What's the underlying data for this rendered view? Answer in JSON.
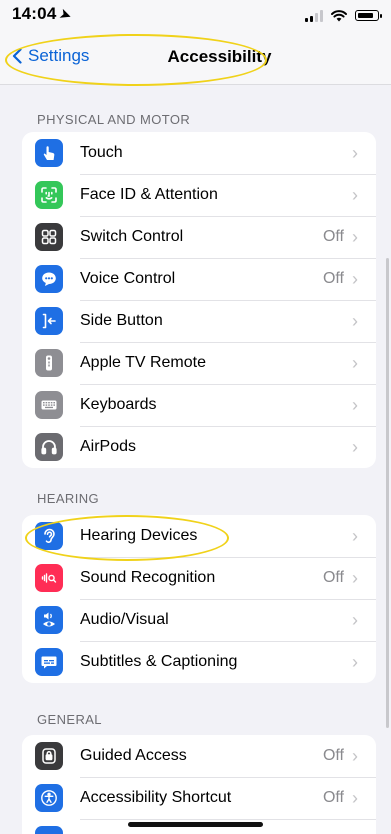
{
  "status": {
    "time": "14:04"
  },
  "nav": {
    "back_label": "Settings",
    "title": "Accessibility"
  },
  "sections": [
    {
      "header": "PHYSICAL AND MOTOR",
      "items": [
        {
          "label": "Touch",
          "value": "",
          "icon": "touch-hand-icon",
          "color": "#1f6fe4"
        },
        {
          "label": "Face ID & Attention",
          "value": "",
          "icon": "face-id-icon",
          "color": "#34c759"
        },
        {
          "label": "Switch Control",
          "value": "Off",
          "icon": "switch-control-icon",
          "color": "#3a3a3c"
        },
        {
          "label": "Voice Control",
          "value": "Off",
          "icon": "voice-control-icon",
          "color": "#1f6fe4"
        },
        {
          "label": "Side Button",
          "value": "",
          "icon": "side-button-icon",
          "color": "#1f6fe4"
        },
        {
          "label": "Apple TV Remote",
          "value": "",
          "icon": "tv-remote-icon",
          "color": "#8e8e93"
        },
        {
          "label": "Keyboards",
          "value": "",
          "icon": "keyboard-icon",
          "color": "#8e8e93"
        },
        {
          "label": "AirPods",
          "value": "",
          "icon": "airpods-icon",
          "color": "#6b6b70"
        }
      ]
    },
    {
      "header": "HEARING",
      "items": [
        {
          "label": "Hearing Devices",
          "value": "",
          "icon": "ear-icon",
          "color": "#1f6fe4"
        },
        {
          "label": "Sound Recognition",
          "value": "Off",
          "icon": "sound-recognition-icon",
          "color": "#ff2d55"
        },
        {
          "label": "Audio/Visual",
          "value": "",
          "icon": "audio-visual-icon",
          "color": "#1f6fe4"
        },
        {
          "label": "Subtitles & Captioning",
          "value": "",
          "icon": "subtitles-icon",
          "color": "#1f6fe4"
        }
      ]
    },
    {
      "header": "GENERAL",
      "items": [
        {
          "label": "Guided Access",
          "value": "Off",
          "icon": "guided-access-icon",
          "color": "#3a3a3c"
        },
        {
          "label": "Accessibility Shortcut",
          "value": "Off",
          "icon": "accessibility-shortcut-icon",
          "color": "#1f6fe4"
        }
      ]
    }
  ],
  "highlight_color": "#f0d21a"
}
